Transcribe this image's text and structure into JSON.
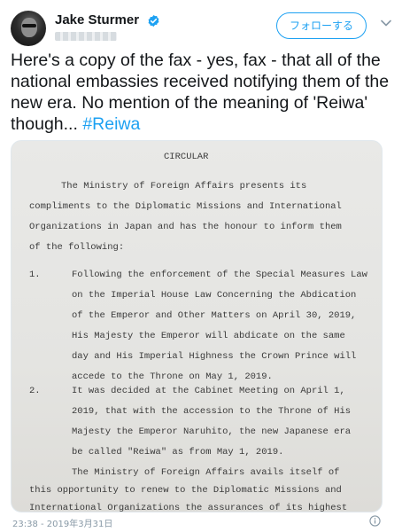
{
  "author": {
    "display_name": "Jake Sturmer",
    "follow_label": "フォローする"
  },
  "tweet": {
    "text_main": "Here's a copy of the fax - yes, fax - that all of the national embassies received notifying them of the new era. No mention of the meaning of 'Reiwa' though... ",
    "hashtag": "#Reiwa",
    "timestamp": "23:38 - 2019年3月31日"
  },
  "fax": {
    "heading": "CIRCULAR",
    "intro": [
      "The Ministry of Foreign Affairs presents its",
      "compliments to the Diplomatic Missions and International",
      "Organizations in Japan and has the honour to inform them",
      "of the following:"
    ],
    "items": [
      {
        "number": "1.",
        "lines": [
          "Following the enforcement of the Special Measures Law",
          "on the Imperial House Law Concerning the Abdication",
          "of the Emperor and Other Matters on April 30, 2019,",
          "His Majesty the Emperor will abdicate on the same",
          "day and His Imperial Highness the Crown Prince will",
          "accede to the Throne on May 1, 2019."
        ]
      },
      {
        "number": "2.",
        "lines": [
          "It was decided at the Cabinet Meeting on April 1,",
          "2019, that with the accession to the Throne of His",
          "Majesty the Emperor Naruhito, the new Japanese era",
          "be called \"Reiwa\" as from May 1, 2019."
        ]
      }
    ],
    "closing": [
      "The Ministry of Foreign Affairs avails itself of",
      "this opportunity to renew to the Diplomatic Missions and",
      "International Organizations the assurances of its highest"
    ]
  },
  "colors": {
    "accent": "#1da1f2",
    "text": "#14171a",
    "muted": "#8899a6"
  },
  "icons": {
    "verified": "verified-badge-icon",
    "chevron": "chevron-down-icon",
    "info": "info-icon"
  }
}
